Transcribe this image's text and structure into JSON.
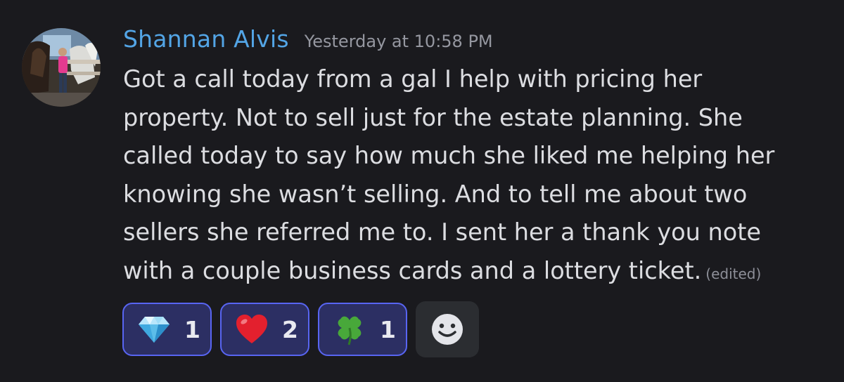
{
  "message": {
    "author": "Shannan Alvis",
    "timestamp": "Yesterday at 10:58 PM",
    "content_lines": [
      "Got a call today from a gal I help with pricing her",
      "property. Not to sell just for the estate planning. She",
      "called today to say how much she liked me helping her",
      "knowing she wasn’t selling. And to tell me about two",
      "sellers she referred me to. I sent her a thank you note",
      "with a couple business cards and a lottery ticket."
    ],
    "edited_label": "(edited)",
    "avatar": "avatar-photo-person-with-horses"
  },
  "reactions": [
    {
      "emoji": "gem-emoji",
      "count": "1"
    },
    {
      "emoji": "red-heart-emoji",
      "count": "2"
    },
    {
      "emoji": "four-leaf-clover-emoji",
      "count": "1"
    }
  ],
  "add_reaction": {
    "icon": "smiley-add-reaction-icon"
  },
  "colors": {
    "background": "#1a1a1e",
    "username": "#53a5e6",
    "text": "#dcdde1",
    "muted": "#9597a0",
    "reaction_bg": "#2c2f63",
    "reaction_border": "#5865f2"
  }
}
